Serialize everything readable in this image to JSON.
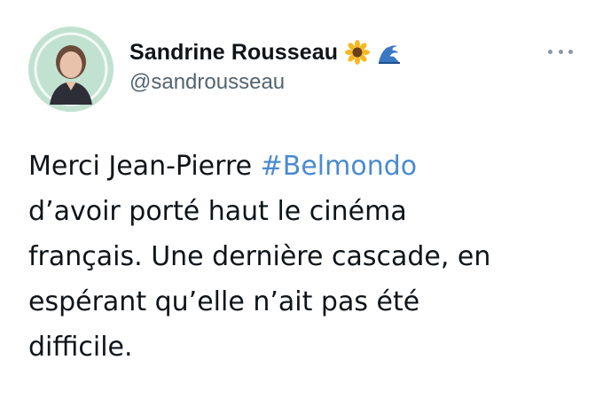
{
  "author": {
    "display_name": "Sandrine Rousseau",
    "handle": "@sandrousseau",
    "badges": [
      "sunflower-icon",
      "wave-icon"
    ]
  },
  "tweet": {
    "text_before_hashtag": "Merci Jean-Pierre ",
    "hashtag": "#Belmondo",
    "text_after_hashtag": "\nd’avoir porté haut le cinéma\nfrançais. Une dernière cascade, en\nespérant qu’elle n’ait pas été\ndifficile."
  },
  "actions": {
    "more_icon": "more-options-icon"
  },
  "colors": {
    "hashtag": "#4a8bd0",
    "text": "#0f1419",
    "handle": "#536471",
    "avatar_bg": "#b9dcc9"
  }
}
